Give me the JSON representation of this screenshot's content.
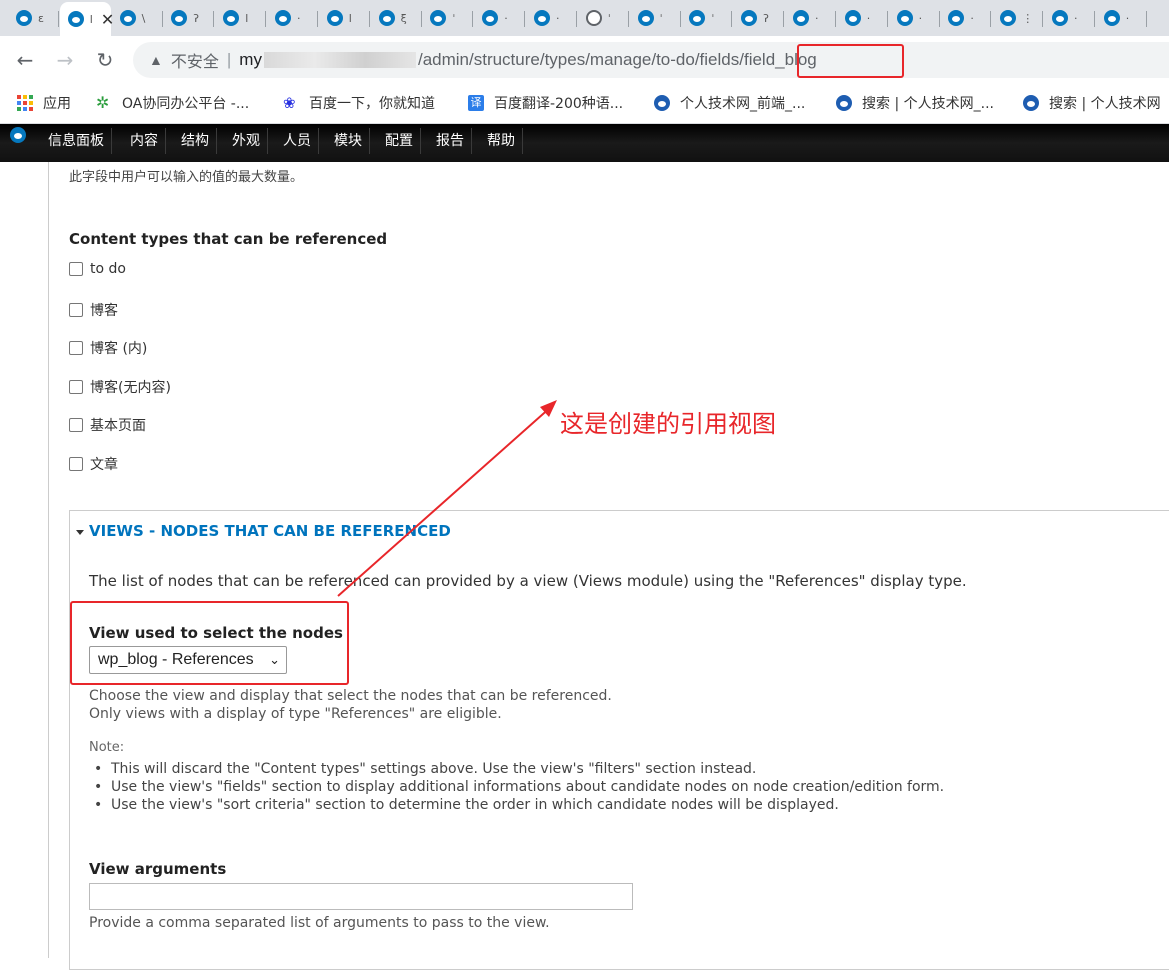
{
  "browser": {
    "tabs": [
      {
        "kind": "drupal",
        "label": "ε"
      },
      {
        "kind": "drupal",
        "label": "l",
        "active": true,
        "close": "✕"
      },
      {
        "kind": "drupal",
        "label": "\\"
      },
      {
        "kind": "drupal",
        "label": "ʔ"
      },
      {
        "kind": "drupal",
        "label": "l"
      },
      {
        "kind": "drupal",
        "label": "·"
      },
      {
        "kind": "drupal",
        "label": "l"
      },
      {
        "kind": "drupal",
        "label": "ξ"
      },
      {
        "kind": "drupal",
        "label": "ˈ"
      },
      {
        "kind": "drupal",
        "label": "·"
      },
      {
        "kind": "drupal",
        "label": "·"
      },
      {
        "kind": "globe",
        "label": "ˈ"
      },
      {
        "kind": "drupal",
        "label": "ˈ"
      },
      {
        "kind": "drupal",
        "label": "ˈ"
      },
      {
        "kind": "drupal",
        "label": "ʔ"
      },
      {
        "kind": "drupal",
        "label": "·"
      },
      {
        "kind": "drupal",
        "label": "·"
      },
      {
        "kind": "drupal",
        "label": "·"
      },
      {
        "kind": "drupal",
        "label": "·"
      },
      {
        "kind": "drupal",
        "label": "⋮"
      },
      {
        "kind": "drupal",
        "label": "·"
      },
      {
        "kind": "drupal",
        "label": "·"
      }
    ],
    "address": {
      "security_label": "不安全",
      "separator": "|",
      "host_prefix": "my",
      "path": "/admin/structure/types/manage/to-do/fields/",
      "highlighted_segment": "field_blog"
    },
    "bookmarks": [
      {
        "icon": "apps-grid-icon",
        "label": "应用"
      },
      {
        "icon": "oa-flower-icon",
        "label": "OA协同办公平台 -..."
      },
      {
        "icon": "baidu-paw-icon",
        "label": "百度一下，你就知道"
      },
      {
        "icon": "translate-icon",
        "label": "百度翻译-200种语..."
      },
      {
        "icon": "drupal-icon",
        "label": "个人技术网_前端_..."
      },
      {
        "icon": "drupal-icon",
        "label": "搜索 | 个人技术网_..."
      },
      {
        "icon": "drupal-icon",
        "label": "搜索 | 个人技术网"
      }
    ],
    "colors": {
      "tabstrip": "#dee1e6",
      "highlight": "#e8262a"
    }
  },
  "admin_menu": {
    "items": [
      "信息面板",
      "内容",
      "结构",
      "外观",
      "人员",
      "模块",
      "配置",
      "报告",
      "帮助"
    ]
  },
  "form": {
    "max_values_description": "此字段中用户可以输入的值的最大数量。",
    "content_types": {
      "title": "Content types that can be referenced",
      "options": [
        "to do",
        "博客",
        "博客 (内)",
        "博客(无内容)",
        "基本页面",
        "文章"
      ]
    },
    "views_fieldset": {
      "legend": "VIEWS - NODES THAT CAN BE REFERENCED",
      "description": "The list of nodes that can be referenced can provided by a view (Views module) using the \"References\" display type.",
      "view_label": "View used to select the nodes",
      "view_selected": "wp_blog - References",
      "help_line1": "Choose the view and display that select the nodes that can be referenced.",
      "help_line2": "Only views with a display of type \"References\" are eligible.",
      "note_label": "Note:",
      "notes": [
        "This will discard the \"Content types\" settings above. Use the view's \"filters\" section instead.",
        "Use the view's \"fields\" section to display additional informations about candidate nodes on node creation/edition form.",
        "Use the view's \"sort criteria\" section to determine the order in which candidate nodes will be displayed."
      ],
      "args_label": "View arguments",
      "args_value": "",
      "args_help": "Provide a comma separated list of arguments to pass to the view."
    }
  },
  "annotation": {
    "text": "这是创建的引用视图",
    "color": "#e8262a"
  }
}
